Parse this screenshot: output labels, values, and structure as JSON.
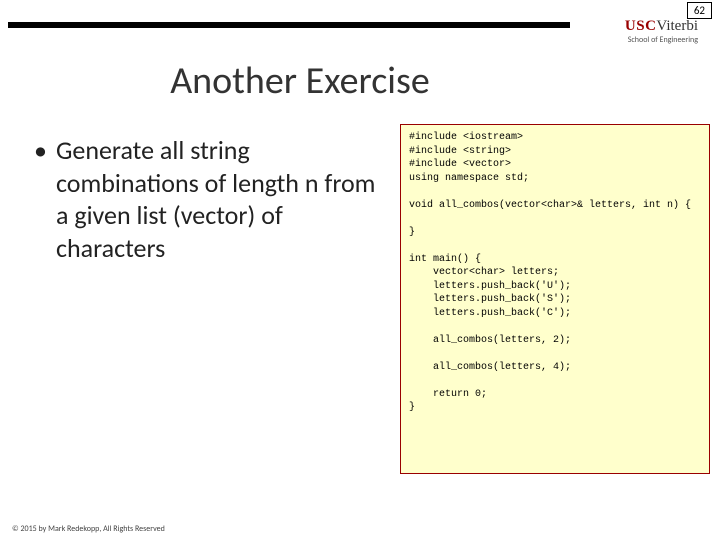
{
  "page_number": "62",
  "logo": {
    "usc": "USC",
    "viterbi": "Viterbi",
    "subtitle": "School of Engineering"
  },
  "title": "Another Exercise",
  "bullet": "Generate all string combinations of length n from a given list (vector) of characters",
  "code": "#include <iostream>\n#include <string>\n#include <vector>\nusing namespace std;\n\nvoid all_combos(vector<char>& letters, int n) {\n\n}\n\nint main() {\n    vector<char> letters;\n    letters.push_back('U');\n    letters.push_back('S');\n    letters.push_back('C');\n\n    all_combos(letters, 2);\n\n    all_combos(letters, 4);\n\n    return 0;\n}",
  "footer": "© 2015 by Mark Redekopp, All Rights Reserved"
}
